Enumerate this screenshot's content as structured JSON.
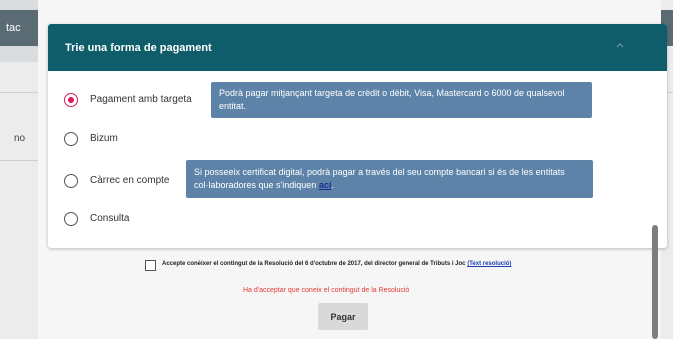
{
  "background": {
    "left_header_fragment": "tac",
    "left_text_fragment": "no"
  },
  "card": {
    "title": "Trie una forma de pagament"
  },
  "options": [
    {
      "label": "Pagament amb targeta",
      "checked": true
    },
    {
      "label": "Bizum",
      "checked": false
    },
    {
      "label": "Càrrec en compte",
      "checked": false
    },
    {
      "label": "Consulta",
      "checked": false
    }
  ],
  "tooltips": {
    "card": "Podrà pagar mitjançant targeta de crèdit o dèbit, Visa, Mastercard o 6000 de qualsevol entitat.",
    "account_before": "Si posseeix certificat digital, podrà pagar a través del seu compte bancari si és de les entitats col·laboradores que s'indiquen",
    "account_link": "ací",
    "account_after": "."
  },
  "accept": {
    "text": "Accepte conèixer el contingut de la Resolució del 6 d'octubre de 2017, del director general de Tributs i Joc",
    "link": "(Text resolució)"
  },
  "error": "Ha d'acceptar que coneix el contingut de la Resolució",
  "pay_button": "Pagar",
  "colors": {
    "header": "#0f5c6b",
    "tooltip": "#5d84a8",
    "radio_selected": "#d81b60",
    "error": "#e53935"
  }
}
